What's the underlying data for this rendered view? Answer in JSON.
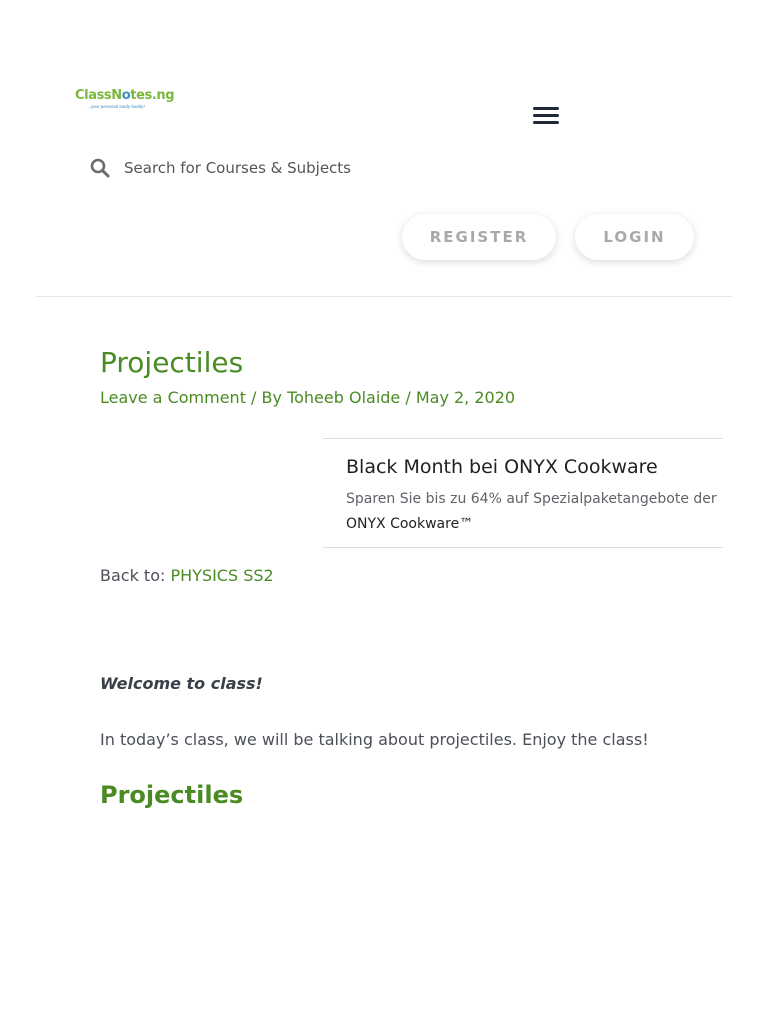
{
  "header": {
    "logo_text_a": "ClassN",
    "logo_text_o": "o",
    "logo_text_b": "tes.ng",
    "logo_tagline": "...your personal study buddy!",
    "menu_icon": "hamburger-menu-icon"
  },
  "search": {
    "placeholder": "Search for Courses & Subjects",
    "icon": "search-icon"
  },
  "auth": {
    "register_label": "REGISTER",
    "login_label": "LOGIN"
  },
  "post": {
    "title": "Projectiles",
    "meta_comment": "Leave a Comment",
    "meta_sep1": " / By ",
    "meta_author": "Toheeb Olaide",
    "meta_sep2": " / ",
    "meta_date": "May 2, 2020"
  },
  "ad": {
    "title": "Black Month bei ONYX Cookware",
    "description": "Sparen Sie bis zu 64% auf Spezialpaketangebote der",
    "brand": "ONYX Cookware™"
  },
  "content": {
    "back_prefix": "Back to: ",
    "back_link": "PHYSICS SS2",
    "welcome": "Welcome to class!",
    "intro": "In today’s class, we will be talking about projectiles. Enjoy the class!",
    "subheading": "Projectiles"
  },
  "colors": {
    "accent_green": "#4a8b24",
    "logo_blue": "#3d8ec2",
    "logo_green": "#7cb63b"
  }
}
